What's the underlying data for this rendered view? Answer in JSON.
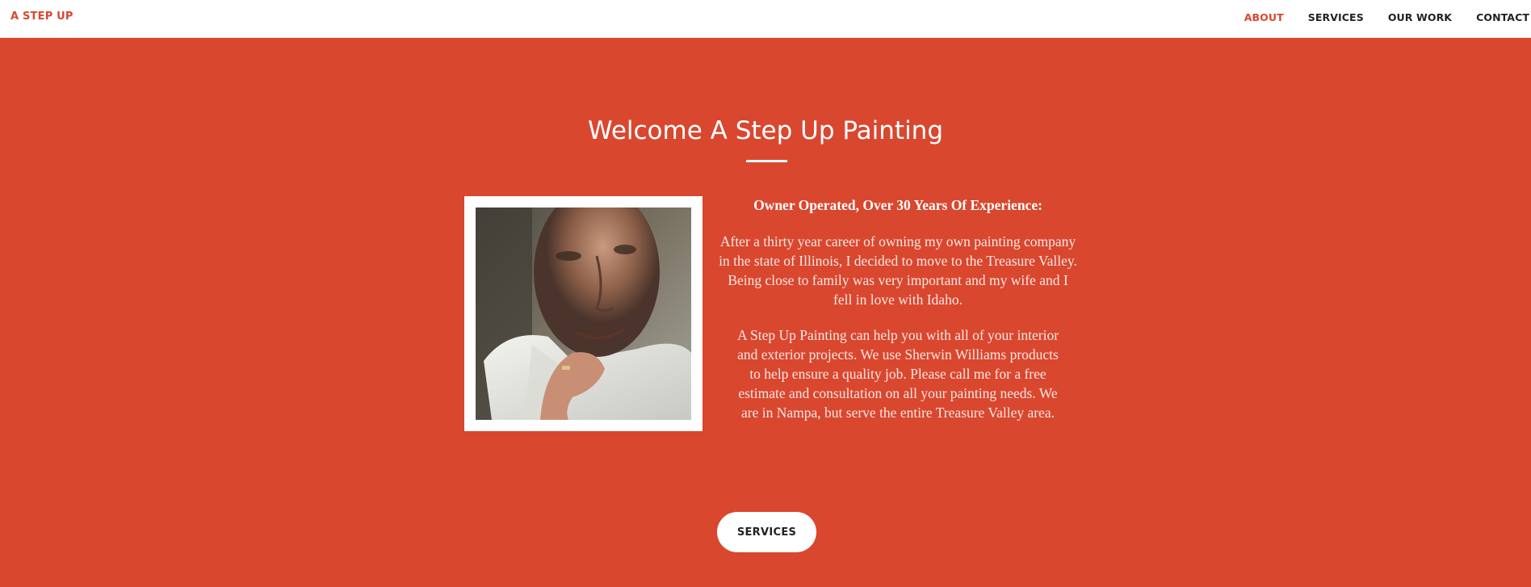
{
  "navbar": {
    "brand": "A STEP UP",
    "links": [
      {
        "label": "ABOUT",
        "active": true
      },
      {
        "label": "SERVICES",
        "active": false
      },
      {
        "label": "OUR WORK",
        "active": false
      },
      {
        "label": "CONTACT",
        "active": false
      }
    ]
  },
  "about": {
    "heading": "Welcome A Step Up Painting",
    "lead": "Owner Operated, Over 30 Years Of Experience:",
    "paragraphs": [
      "After a thirty year career of owning my own painting company in the state of Illinois, I decided to move to the Treasure Valley. Being close to family was very important and my wife and I fell in love with Idaho.",
      "A Step Up Painting can help you with all of your interior and exterior projects. We use Sherwin Williams products to help ensure a quality job. Please call me for a free estimate and consultation on all your painting needs. We are in Nampa, but serve the entire Treasure Valley area."
    ],
    "button_label": "SERVICES"
  },
  "colors": {
    "accent": "#d9472f",
    "nav_background": "#ffffff",
    "nav_text": "#222222",
    "heading_text": "#ffffff"
  }
}
